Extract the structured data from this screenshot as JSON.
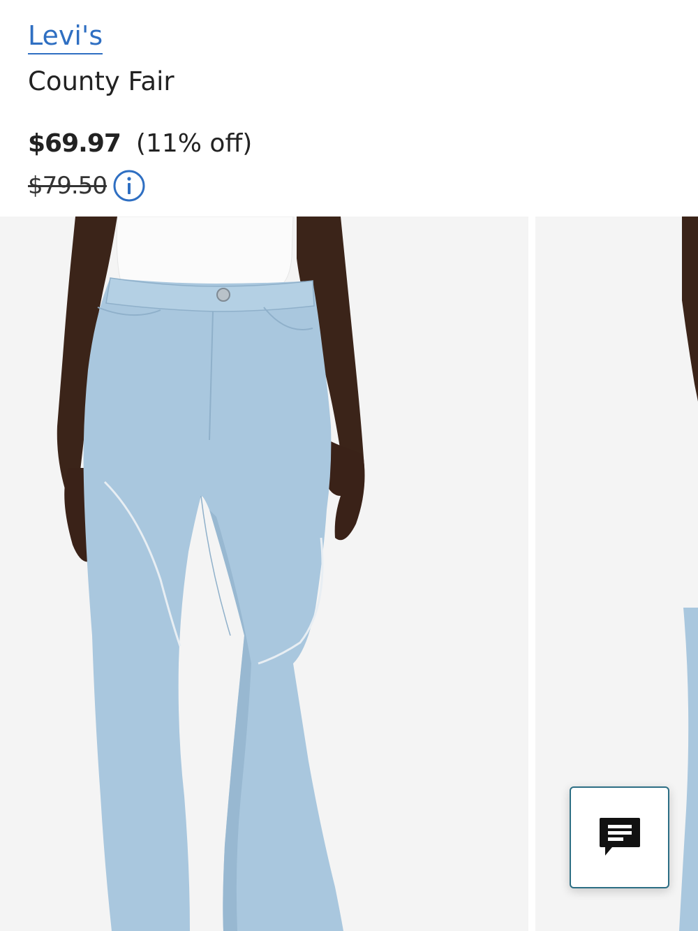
{
  "product": {
    "brand": "Levi's",
    "name": "County Fair",
    "sale_price": "$69.97",
    "discount": "(11% off)",
    "original_price": "$79.50"
  },
  "colors": {
    "brand_link": "#2f6fc2",
    "text": "#222222",
    "photo_bg": "#f4f4f4",
    "denim": "#a9c7de",
    "chat_border": "#2c6e84"
  },
  "icons": {
    "price_info": "info-circle-icon",
    "chat": "chat-bubble-icon"
  }
}
